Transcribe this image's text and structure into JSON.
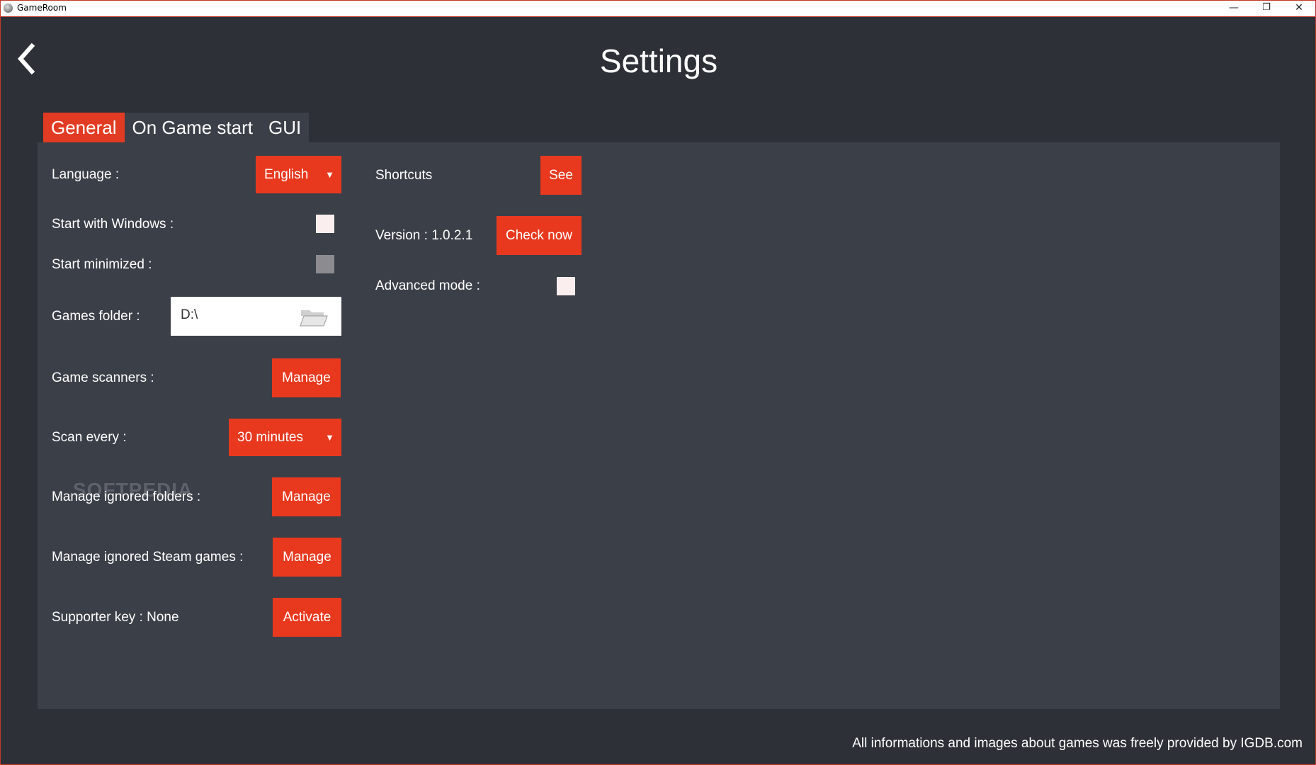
{
  "window": {
    "title": "GameRoom",
    "minimize_glyph": "—",
    "restore_glyph": "❐",
    "close_glyph": "✕"
  },
  "header": {
    "title": "Settings",
    "back_icon": "chevron-left-icon"
  },
  "tabs": [
    {
      "label": "General",
      "active": true
    },
    {
      "label": "On Game start",
      "active": false
    },
    {
      "label": "GUI",
      "active": false
    }
  ],
  "general": {
    "language": {
      "label": "Language :",
      "value": "English"
    },
    "start_with_windows": {
      "label": "Start with Windows :",
      "checked": false
    },
    "start_minimized": {
      "label": "Start minimized :",
      "checked": false,
      "disabled": true
    },
    "games_folder": {
      "label": "Games folder :",
      "value": "D:\\",
      "icon": "folder-open-icon"
    },
    "game_scanners": {
      "label": "Game scanners :",
      "button": "Manage"
    },
    "scan_every": {
      "label": "Scan every :",
      "value": "30 minutes"
    },
    "ignored_folders": {
      "label": "Manage ignored folders :",
      "button": "Manage"
    },
    "ignored_steam": {
      "label": "Manage ignored Steam games :",
      "button": "Manage"
    },
    "supporter_key": {
      "label": "Supporter key : None",
      "button": "Activate"
    }
  },
  "right": {
    "shortcuts": {
      "label": "Shortcuts",
      "button": "See"
    },
    "version": {
      "label": "Version : 1.0.2.1",
      "button": "Check now"
    },
    "advanced_mode": {
      "label": "Advanced mode :",
      "checked": false
    }
  },
  "dropdown_caret": "▼",
  "watermark": "SOFTPEDIA",
  "footer": "All informations and images about games was freely provided by IGDB.com",
  "colors": {
    "accent": "#e8391f",
    "background": "#2d3036",
    "panel": "#3b3f48"
  }
}
